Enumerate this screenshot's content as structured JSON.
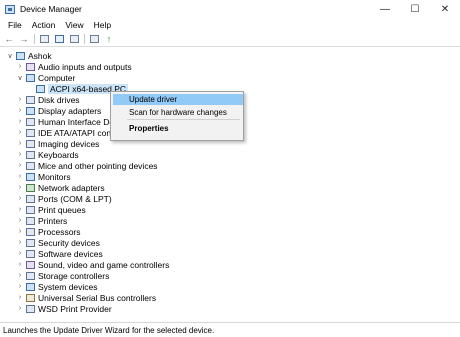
{
  "window": {
    "title": "Device Manager",
    "minimize_icon": "minimize-icon",
    "maximize_icon": "maximize-icon",
    "close_icon": "close-icon"
  },
  "menu": [
    "File",
    "Action",
    "View",
    "Help"
  ],
  "toolbar": [
    "back-arrow-icon",
    "forward-arrow-icon",
    "properties-icon",
    "help-icon",
    "scan-hardware-icon",
    "update-driver-icon"
  ],
  "tree": {
    "root": "Ashok",
    "items": [
      "Audio inputs and outputs",
      "Computer",
      "ACPI x64-based PC",
      "Disk drives",
      "Display adapters",
      "Human Interface Devic",
      "IDE ATA/ATAPI controll",
      "Imaging devices",
      "Keyboards",
      "Mice and other pointing devices",
      "Monitors",
      "Network adapters",
      "Ports (COM & LPT)",
      "Print queues",
      "Printers",
      "Processors",
      "Security devices",
      "Software devices",
      "Sound, video and game controllers",
      "Storage controllers",
      "System devices",
      "Universal Serial Bus controllers",
      "WSD Print Provider"
    ]
  },
  "context_menu": {
    "update_driver": "Update driver",
    "scan": "Scan for hardware changes",
    "properties": "Properties"
  },
  "status": "Launches the Update Driver Wizard for the selected device."
}
